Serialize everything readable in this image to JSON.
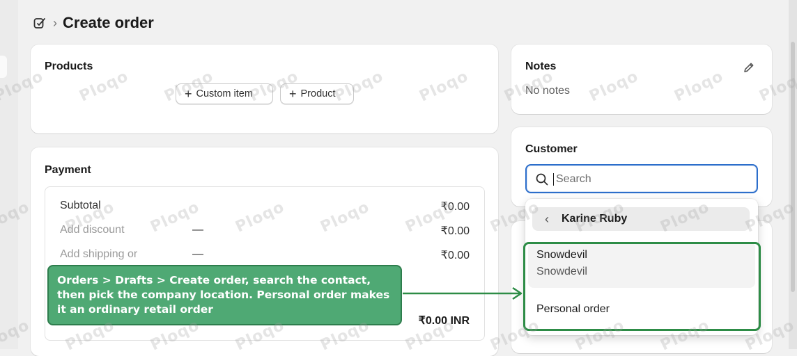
{
  "header": {
    "title": "Create order",
    "separator": "›",
    "icon": "edit-order-icon"
  },
  "products": {
    "title": "Products",
    "custom_item_label": "Custom item",
    "product_label": "Product"
  },
  "payment": {
    "title": "Payment",
    "rows": [
      {
        "label": "Subtotal",
        "mid": "",
        "value": "₹0.00"
      },
      {
        "label": "Add discount",
        "mid": "—",
        "value": "₹0.00"
      },
      {
        "label": "Add shipping or",
        "mid": "—",
        "value": "₹0.00"
      }
    ],
    "total_value": "₹0.00 INR"
  },
  "notes": {
    "title": "Notes",
    "value": "No notes",
    "edit_icon": "pencil-icon"
  },
  "customer": {
    "title": "Customer",
    "search_placeholder": "Search",
    "dropdown": {
      "back_name": "Karine Ruby",
      "option1_line1": "Snowdevil",
      "option1_line2": "Snowdevil",
      "option2": "Personal order"
    }
  },
  "callout": {
    "text": "Orders > Drafts > Create order, search the contact, then pick the company location. Personal order makes it an ordinary retail order"
  },
  "watermark": "Ploqo",
  "colors": {
    "accent_focus": "#2c6ecb",
    "callout_green": "#4fa974",
    "outline_green": "#2d8c46"
  }
}
